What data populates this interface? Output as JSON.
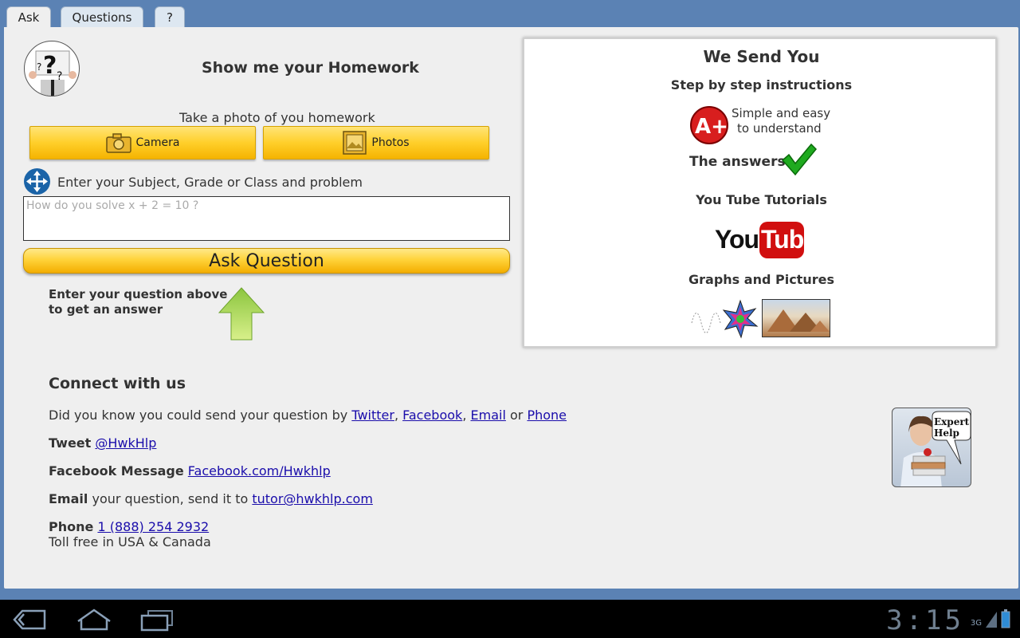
{
  "tabs": [
    {
      "label": "Ask",
      "active": true
    },
    {
      "label": "Questions",
      "active": false
    },
    {
      "label": "?",
      "active": false
    }
  ],
  "header": {
    "title": "Show me your Homework"
  },
  "photo": {
    "prompt": "Take a photo of you homework",
    "camera_label": "Camera",
    "photos_label": "Photos"
  },
  "question": {
    "instruction": "Enter your Subject, Grade or Class and problem",
    "placeholder": "How do you solve x + 2 = 10 ?",
    "ask_label": "Ask Question",
    "hint_line1": "Enter your question above",
    "hint_line2": "to get an answer"
  },
  "send": {
    "title": "We Send You",
    "steps_title": "Step by step instructions",
    "grade_badge": "A+",
    "simple_line1": "Simple and easy",
    "simple_line2": "to understand",
    "answers_label": "The answers",
    "tutorials_title": "You Tube Tutorials",
    "youtube_you": "You",
    "youtube_tube": "Tube",
    "graphs_title": "Graphs and Pictures"
  },
  "connect": {
    "title": "Connect with us",
    "intro_text": "Did you know you could send your question by",
    "links": {
      "twitter": "Twitter",
      "facebook": "Facebook",
      "email": "Email",
      "phone": "Phone"
    },
    "sep_comma": ",",
    "sep_or": "or",
    "tweet_label": "Tweet",
    "tweet_handle": "@HwkHlp",
    "fb_label": "Facebook Message",
    "fb_link": "Facebook.com/Hwkhlp",
    "email_label": "Email",
    "email_text": "your question, send it to",
    "email_address": "tutor@hwkhlp.com",
    "phone_label": "Phone",
    "phone_number": "1 (888) 254 2932",
    "toll_free": "Toll free in USA & Canada"
  },
  "expert": {
    "line1": "Expert",
    "line2": "Help"
  },
  "status": {
    "clock": "3:15",
    "network": "3G"
  },
  "colors": {
    "accent_yellow": "#ffcf2a",
    "link": "#1a0dab",
    "background": "#5b82b4"
  }
}
